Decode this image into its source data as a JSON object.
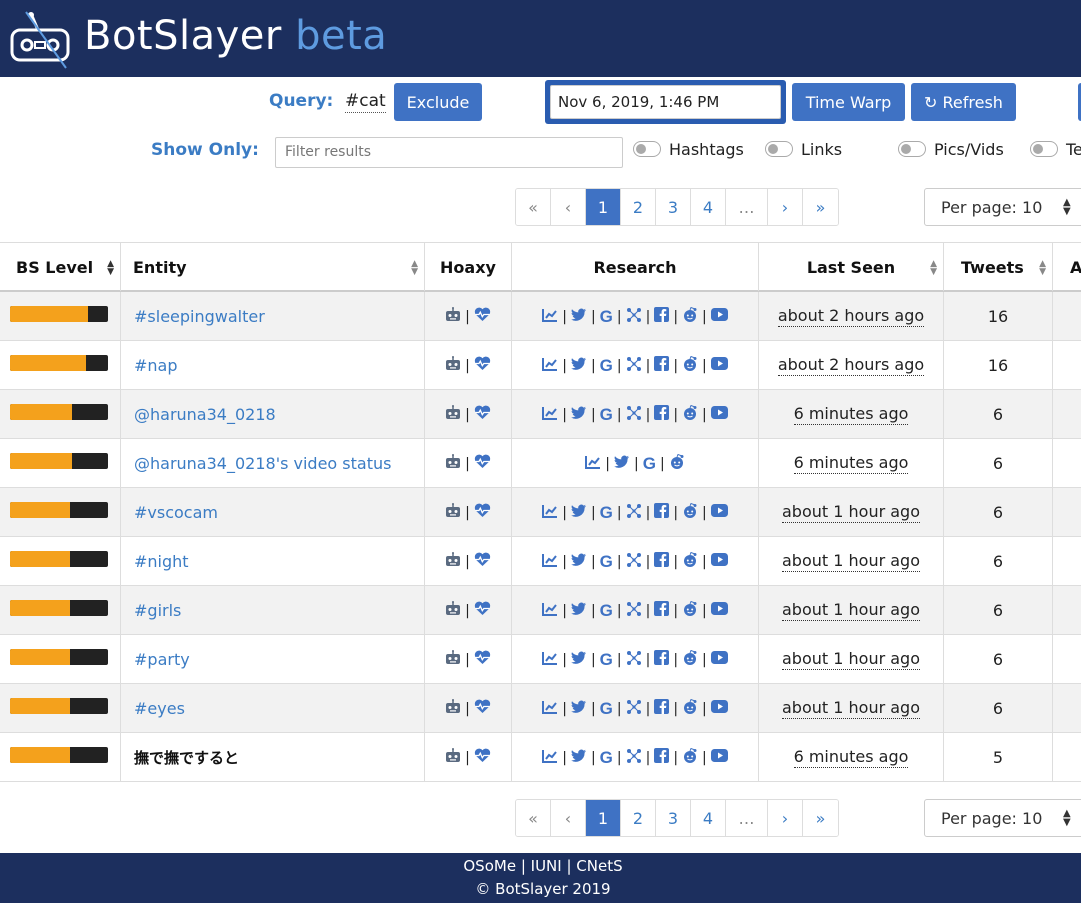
{
  "header": {
    "brand": "BotSlayer",
    "brand_suffix": "beta",
    "logo_icon": "bot-logo-icon"
  },
  "query": {
    "label": "Query:",
    "value": "#cat",
    "exclude_label": "Exclude",
    "date_value": "Nov 6, 2019, 1:46 PM",
    "timewarp_label": "Time Warp",
    "refresh_label": "↻ Refresh"
  },
  "filters": {
    "label": "Show Only:",
    "placeholder": "Filter results",
    "toggles": [
      "Hashtags",
      "Links",
      "Pics/Vids",
      "Te"
    ]
  },
  "pagination": {
    "first": "«",
    "prev": "‹",
    "pages": [
      "1",
      "2",
      "3",
      "4"
    ],
    "ellipsis": "…",
    "next": "›",
    "last": "»",
    "current": "1",
    "per_page": "Per page: 10"
  },
  "table": {
    "columns": [
      "BS Level",
      "Entity",
      "Hoaxy",
      "Research",
      "Last Seen",
      "Tweets",
      "A"
    ],
    "rows": [
      {
        "bs_level": 0.8,
        "entity": "#sleepingwalter",
        "style": "link",
        "research": "full",
        "last_seen": "about 2 hours ago",
        "tweets": "16"
      },
      {
        "bs_level": 0.78,
        "entity": "#nap",
        "style": "link",
        "research": "full",
        "last_seen": "about 2 hours ago",
        "tweets": "16"
      },
      {
        "bs_level": 0.63,
        "entity": "@haruna34_0218",
        "style": "link",
        "research": "full",
        "last_seen": "6 minutes ago",
        "tweets": "6"
      },
      {
        "bs_level": 0.63,
        "entity": "@haruna34_0218's video status",
        "style": "link",
        "research": "short",
        "last_seen": "6 minutes ago",
        "tweets": "6"
      },
      {
        "bs_level": 0.61,
        "entity": "#vscocam",
        "style": "link",
        "research": "full",
        "last_seen": "about 1 hour ago",
        "tweets": "6"
      },
      {
        "bs_level": 0.61,
        "entity": "#night",
        "style": "link",
        "research": "full",
        "last_seen": "about 1 hour ago",
        "tweets": "6"
      },
      {
        "bs_level": 0.61,
        "entity": "#girls",
        "style": "link",
        "research": "full",
        "last_seen": "about 1 hour ago",
        "tweets": "6"
      },
      {
        "bs_level": 0.61,
        "entity": "#party",
        "style": "link",
        "research": "full",
        "last_seen": "about 1 hour ago",
        "tweets": "6"
      },
      {
        "bs_level": 0.61,
        "entity": "#eyes",
        "style": "link",
        "research": "full",
        "last_seen": "about 1 hour ago",
        "tweets": "6"
      },
      {
        "bs_level": 0.61,
        "entity": "撫で撫ですると",
        "style": "bold",
        "research": "full",
        "last_seen": "6 minutes ago",
        "tweets": "5"
      }
    ],
    "research_icons_full": [
      "trend-icon",
      "twitter-icon",
      "google-icon",
      "network-icon",
      "facebook-icon",
      "reddit-icon",
      "youtube-icon"
    ],
    "research_icons_short": [
      "trend-icon",
      "twitter-icon",
      "google-icon",
      "reddit-icon"
    ],
    "hoaxy_icons": [
      "bot-icon",
      "heartbeat-icon"
    ]
  },
  "footer": {
    "links": "OSoMe | IUNI | CNetS",
    "copyright": "© BotSlayer 2019"
  },
  "colors": {
    "navy": "#1c2f5e",
    "accent": "#3f72c4",
    "bar_fill": "#f4a11c",
    "bar_bg": "#222222"
  }
}
